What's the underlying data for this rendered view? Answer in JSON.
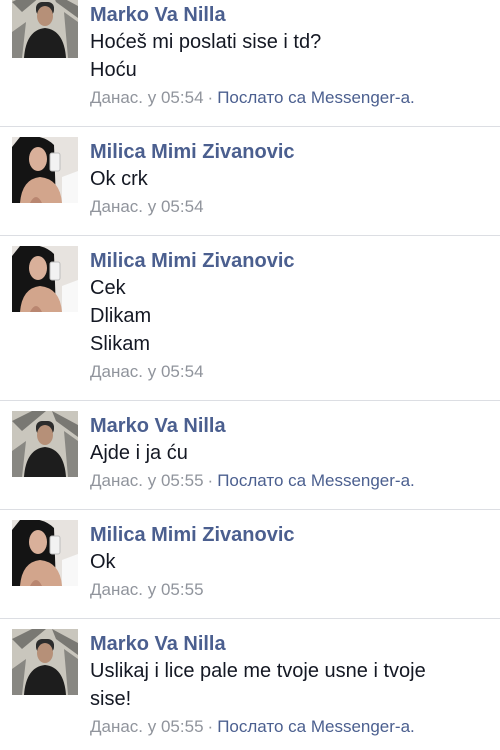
{
  "messages": [
    {
      "author": "Marko Va Nilla",
      "avatar_icon": "male-profile-photo",
      "lines": [
        "Hoćeš mi poslati sise i td?",
        "Hoću"
      ],
      "time": "Данас. у 05:54",
      "separator": "·",
      "source": "Послато са Messenger-a."
    },
    {
      "author": "Milica Mimi Zivanovic",
      "avatar_icon": "female-profile-photo",
      "lines": [
        "Ok crk"
      ],
      "time": "Данас. у 05:54"
    },
    {
      "author": "Milica Mimi Zivanovic",
      "avatar_icon": "female-profile-photo",
      "lines": [
        "Cek",
        "Dlikam",
        "Slikam"
      ],
      "time": "Данас. у 05:54"
    },
    {
      "author": "Marko Va Nilla",
      "avatar_icon": "male-profile-photo",
      "lines": [
        "Ajde i ja ću"
      ],
      "time": "Данас. у 05:55",
      "separator": "·",
      "source": "Послато са Messenger-a."
    },
    {
      "author": "Milica Mimi Zivanovic",
      "avatar_icon": "female-profile-photo",
      "lines": [
        "Ok"
      ],
      "time": "Данас. у 05:55"
    },
    {
      "author": "Marko Va Nilla",
      "avatar_icon": "male-profile-photo",
      "lines": [
        "Uslikaj i lice pale me tvoje usne i tvoje",
        "sise!"
      ],
      "time": "Данас. у 05:55",
      "separator": "·",
      "source": "Послато са Messenger-a."
    }
  ],
  "colors": {
    "author": "#4b5f8f",
    "text": "#141823",
    "meta": "#90949c",
    "divider": "#dcdee3"
  }
}
